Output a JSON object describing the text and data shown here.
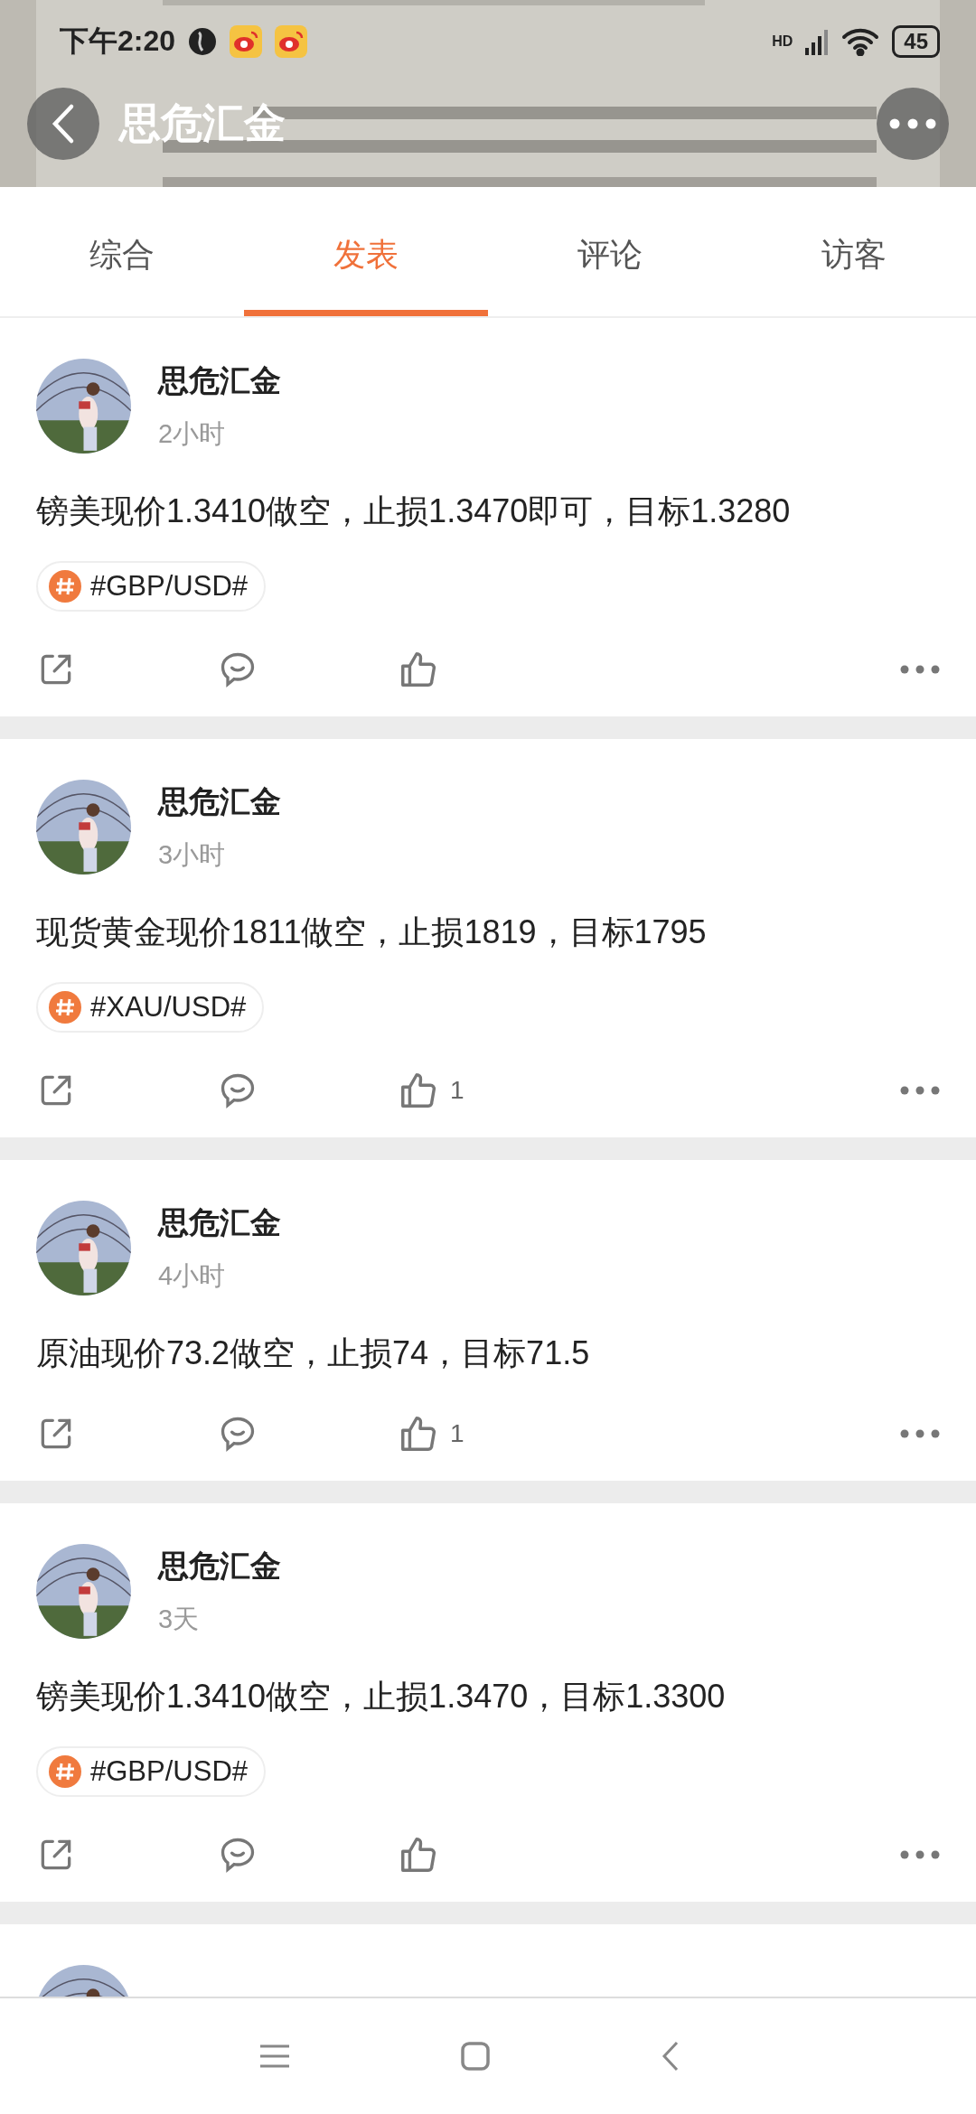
{
  "status_bar": {
    "time": "下午2:20",
    "network": "HD",
    "battery": "45"
  },
  "header": {
    "title": "思危汇金"
  },
  "tabs": [
    {
      "label": "综合",
      "selected": false
    },
    {
      "label": "发表",
      "selected": true
    },
    {
      "label": "评论",
      "selected": false
    },
    {
      "label": "访客",
      "selected": false
    }
  ],
  "posts": [
    {
      "author": "思危汇金",
      "time": "2小时",
      "text": "镑美现价1.3410做空，止损1.3470即可，目标1.3280",
      "tag": "#GBP/USD#"
    },
    {
      "author": "思危汇金",
      "time": "3小时",
      "text": "现货黄金现价1811做空，止损1819，目标1795",
      "tag": "#XAU/USD#",
      "likes": "1"
    },
    {
      "author": "思危汇金",
      "time": "4小时",
      "text": "原油现价73.2做空，止损74，目标71.5",
      "likes": "1"
    },
    {
      "author": "思危汇金",
      "time": "3天",
      "text": "镑美现价1.3410做空，止损1.3470，目标1.3300",
      "tag": "#GBP/USD#"
    }
  ]
}
